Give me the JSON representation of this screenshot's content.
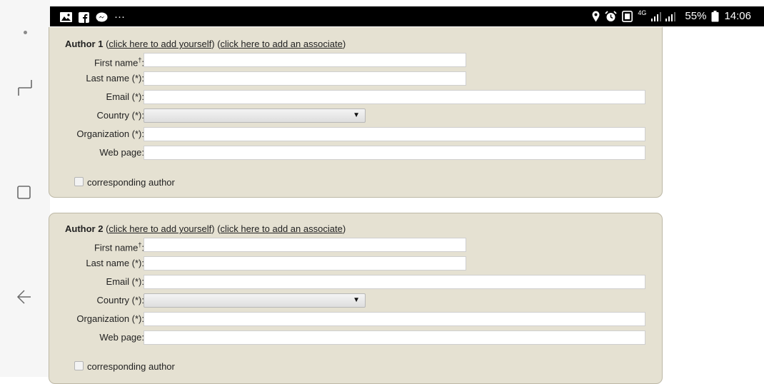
{
  "status_bar": {
    "left_icons": [
      "gallery-icon",
      "facebook-icon",
      "messenger-icon",
      "more-notifications-icon"
    ],
    "more_label": "···",
    "right_icons": [
      "location-icon",
      "alarm-icon",
      "nfc-icon"
    ],
    "network_label": "4G",
    "battery_percent": "55%",
    "time": "14:06"
  },
  "nav": {
    "icons": [
      "recent-dot-icon",
      "recent-apps-icon",
      "home-icon",
      "back-icon"
    ]
  },
  "authors": [
    {
      "title": "Author 1",
      "add_yourself_link": "click here to add yourself",
      "add_associate_link": "click here to add an associate",
      "open_paren": "(",
      "close_paren": ")",
      "fields": {
        "first_name_label": "First name",
        "first_name_mark": "†",
        "first_name_colon": ":",
        "last_name_label": "Last name (*):",
        "email_label": "Email (*):",
        "country_label": "Country (*):",
        "organization_label": "Organization (*):",
        "web_page_label": "Web page:"
      },
      "values": {
        "first_name": "",
        "last_name": "",
        "email": "",
        "country": "",
        "organization": "",
        "web_page": ""
      },
      "corresponding_author_label": "corresponding author",
      "corresponding_author_checked": false
    },
    {
      "title": "Author 2",
      "add_yourself_link": "click here to add yourself",
      "add_associate_link": "click here to add an associate",
      "open_paren": "(",
      "close_paren": ")",
      "fields": {
        "first_name_label": "First name",
        "first_name_mark": "†",
        "first_name_colon": ":",
        "last_name_label": "Last name (*):",
        "email_label": "Email (*):",
        "country_label": "Country (*):",
        "organization_label": "Organization (*):",
        "web_page_label": "Web page:"
      },
      "values": {
        "first_name": "",
        "last_name": "",
        "email": "",
        "country": "",
        "organization": "",
        "web_page": ""
      },
      "corresponding_author_label": "corresponding author",
      "corresponding_author_checked": false
    }
  ],
  "select_arrow_glyph": "▼"
}
